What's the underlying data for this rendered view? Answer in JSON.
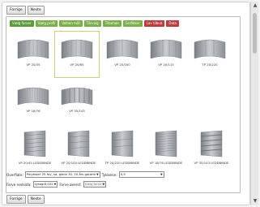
{
  "nav": {
    "back": "Forrige",
    "next": "Neste"
  },
  "tabs": [
    {
      "label": "Vælg farver",
      "color": "#5a9e3a"
    },
    {
      "label": "Vælg profil",
      "color": "#7ab04a"
    },
    {
      "label": "Velhen mål",
      "color": "#7ab04a"
    },
    {
      "label": "Tilsvaig",
      "color": "#7ab04a"
    },
    {
      "label": "Tilbehøe",
      "color": "#7ab04a"
    },
    {
      "label": "Grsfikker",
      "color": "#7ab04a"
    },
    {
      "label": "Lav tilbud",
      "color": "#c43a3a"
    },
    {
      "label": "Data",
      "color": "#c43a3a"
    }
  ],
  "profiles_row1": [
    "VP 20/35",
    "VP 20/65",
    "VP 20/100",
    "VP 20/115",
    "TP 20/220"
  ],
  "profiles_row2": [
    "VP 18/76",
    "VP 35/143"
  ],
  "profiles_row3": [
    "VP 20/45 LEDDBINDE",
    "VP 20/100 LEDDBINDE",
    "TP 20/220 LEDDBINDE",
    "VP 18/76 LEDDBINDE",
    "VP 35/143 LEDDBINDE"
  ],
  "form": {
    "overflate_label": "Overflate:",
    "overflate_value": "Polyester 25 my, sa. glans 30, 20 års garanti",
    "tykkelse_label": "Tykkelse:",
    "tykkelse_value": "0,5",
    "farve_label": "Farve nedsida:",
    "farve_value": "Lysegrå 022",
    "farve2_label": "Farve øverst:",
    "farve2_value": "Vælg farve"
  },
  "accent": {
    "selected_border": "#c9cf7a"
  }
}
